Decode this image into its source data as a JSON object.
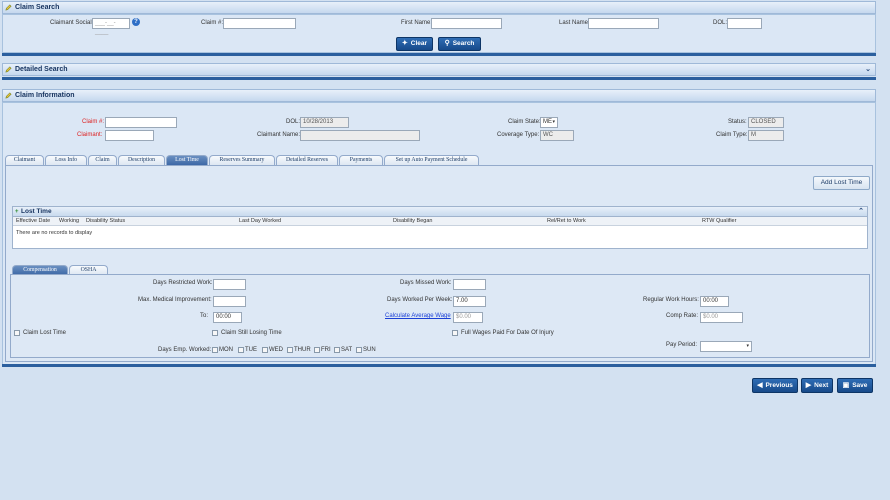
{
  "claim_search": {
    "title": "Claim Search",
    "claimant_social_label": "Claimant Social:",
    "claimant_social_placeholder": "___-__-____",
    "claim_no_label": "Claim #:",
    "first_name_label": "First Name:",
    "last_name_label": "Last Name:",
    "dol_label": "DOL:",
    "clear_label": "Clear",
    "search_label": "Search"
  },
  "detailed_search": {
    "title": "Detailed Search"
  },
  "claim_information": {
    "title": "Claim Information",
    "claim_no_label": "Claim #:",
    "claimant_label": "Claimant:",
    "dol_label": "DOL:",
    "dol_value": "10/28/2013",
    "claimant_name_label": "Claimant Name:",
    "claim_state_label": "Claim State:",
    "claim_state_value": "ME",
    "coverage_type_label": "Coverage Type:",
    "coverage_type_value": "WC",
    "status_label": "Status:",
    "status_value": "CLOSED",
    "claim_type_label": "Claim Type:",
    "claim_type_value": "M"
  },
  "tabs": [
    "Claimant",
    "Loss Info",
    "Claim",
    "Description",
    "Lost Time",
    "Reserves Summary",
    "Detailed Reserves",
    "Payments",
    "Set up Auto Payment Schedule"
  ],
  "active_tab": "Lost Time",
  "add_lost_time_label": "Add Lost Time",
  "lost_time_grid": {
    "title": "Lost Time",
    "columns": [
      "Effective Date",
      "Working",
      "Disability Status",
      "Last Day Worked",
      "Disability Began",
      "Rel/Ret to Work",
      "RTW Qualifier"
    ],
    "empty_text": "There are no records to display"
  },
  "sub_tabs": [
    "Compensation",
    "OSHA"
  ],
  "compensation": {
    "days_restricted_label": "Days Restricted Work:",
    "max_medical_label": "Max. Medical Improvement:",
    "to_label": "To:",
    "to_value": "00:00",
    "days_missed_label": "Days Missed Work:",
    "days_worked_label": "Days Worked Per Week:",
    "days_worked_value": "7.00",
    "calc_avg_wage_label": "Calculate Average Wage",
    "avg_wage_value": "$0.00",
    "regular_hours_label": "Regular Work Hours:",
    "regular_hours_value": "00:00",
    "comp_rate_label": "Comp Rate:",
    "comp_rate_value": "$0.00",
    "claim_lost_time_label": "Claim Lost Time",
    "claim_still_losing_label": "Claim Still Losing Time",
    "full_wages_label": "Full Wages Paid For Date Of Injury",
    "days_emp_worked_label": "Days Emp. Worked:",
    "days": [
      "MON",
      "TUE",
      "WED",
      "THUR",
      "FRI",
      "SAT",
      "SUN"
    ],
    "pay_period_label": "Pay Period:"
  },
  "nav": {
    "previous_label": "Previous",
    "next_label": "Next",
    "save_label": "Save"
  }
}
